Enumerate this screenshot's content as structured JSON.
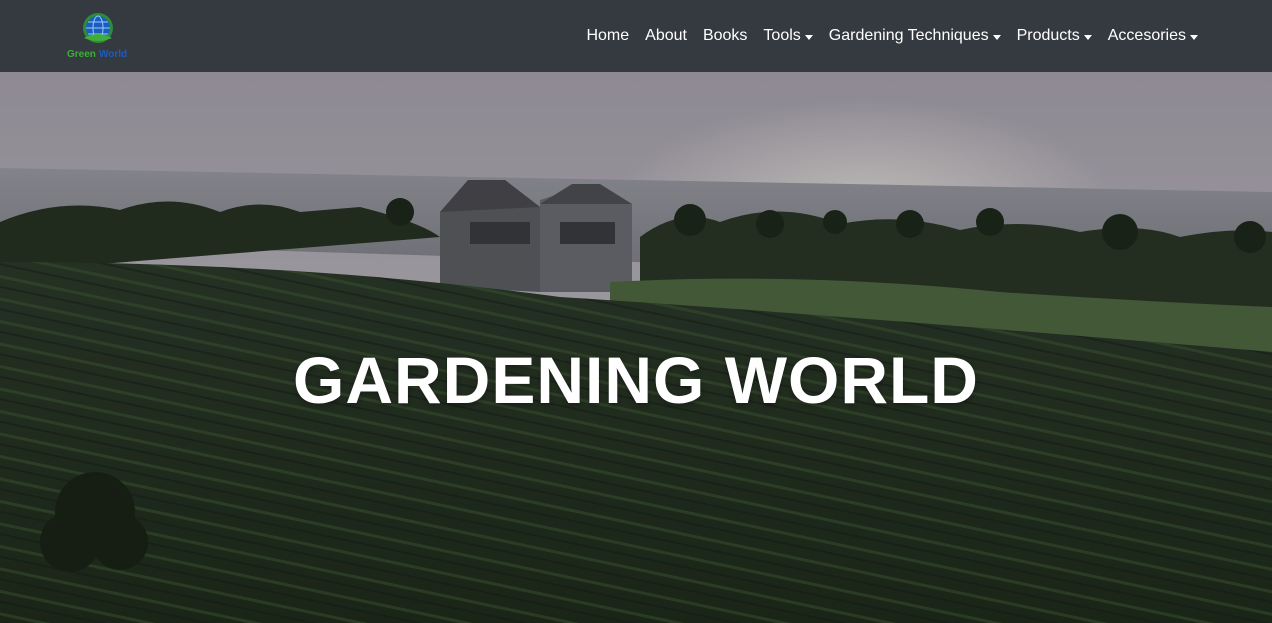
{
  "brand": {
    "logo_text_1": "Green",
    "logo_text_2": "World"
  },
  "nav": {
    "items": [
      {
        "label": "Home",
        "dropdown": false
      },
      {
        "label": "About",
        "dropdown": false
      },
      {
        "label": "Books",
        "dropdown": false
      },
      {
        "label": "Tools",
        "dropdown": true
      },
      {
        "label": "Gardening Techniques",
        "dropdown": true
      },
      {
        "label": "Products",
        "dropdown": true
      },
      {
        "label": "Accesories",
        "dropdown": true
      }
    ]
  },
  "hero": {
    "title": "GARDENING WORLD"
  },
  "colors": {
    "navbar_bg": "#343a40",
    "logo_green": "#3fae3a",
    "logo_blue": "#1e5bbf",
    "text": "#ffffff"
  }
}
